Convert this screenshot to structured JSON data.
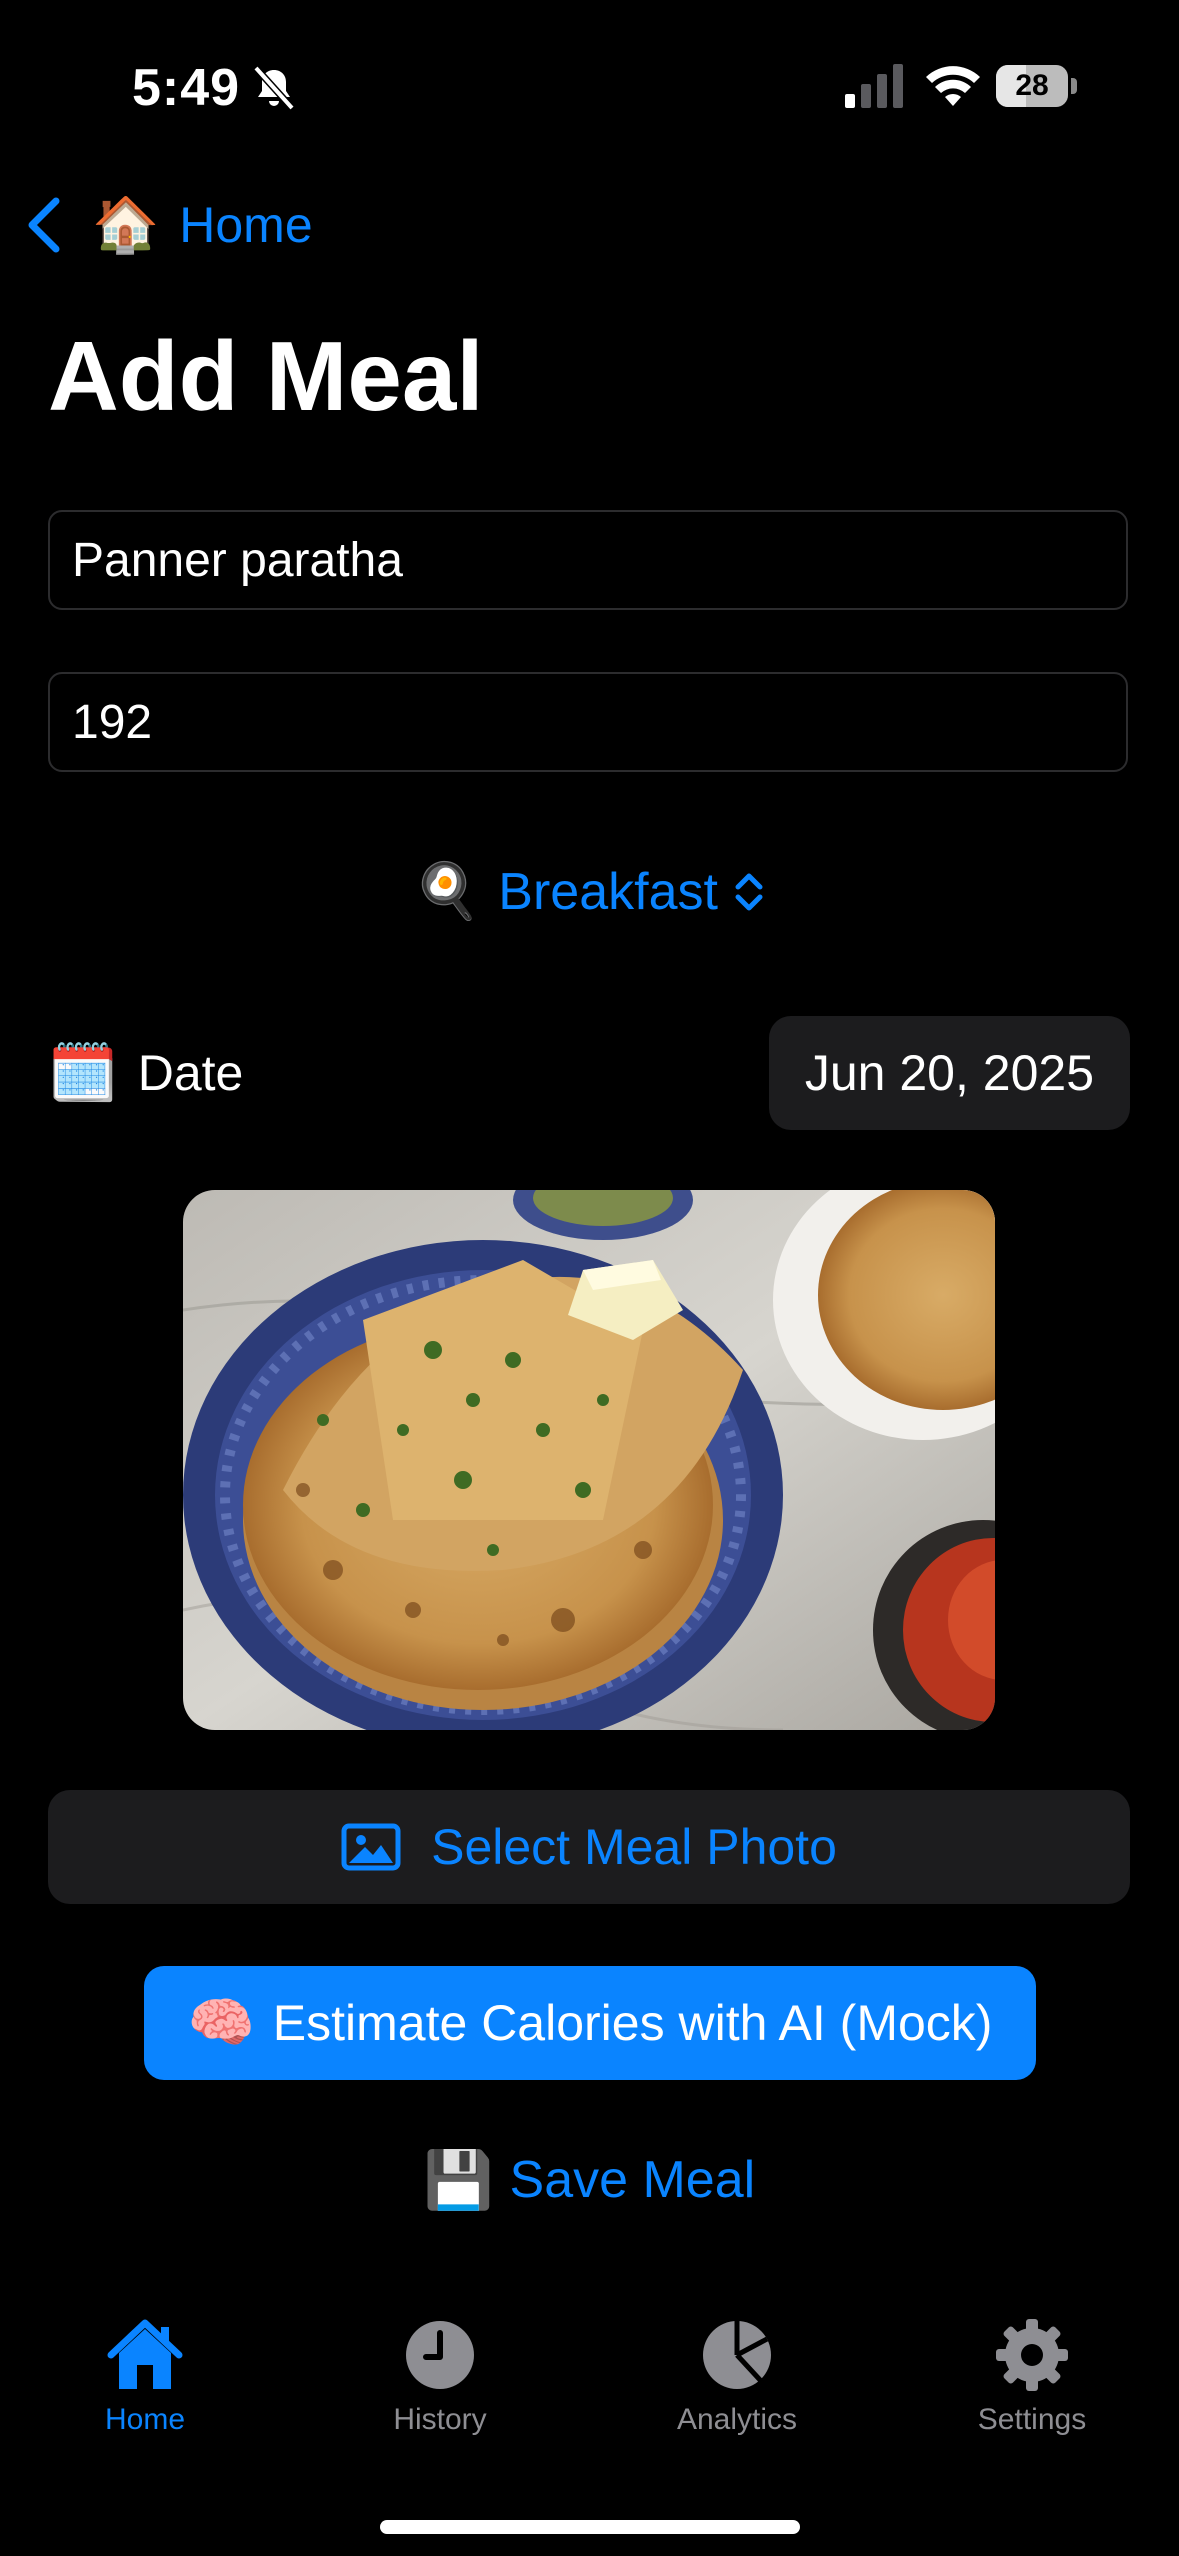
{
  "status_bar": {
    "time": "5:49",
    "battery": "28"
  },
  "nav": {
    "back_emoji": "🏠",
    "back_label": "Home"
  },
  "page": {
    "title": "Add Meal"
  },
  "form": {
    "meal_name": "Panner paratha",
    "calories": "192",
    "meal_type_emoji": "🍳",
    "meal_type": "Breakfast",
    "date_emoji": "🗓️",
    "date_label": "Date",
    "date_value": "Jun 20, 2025"
  },
  "actions": {
    "select_photo": "Select Meal Photo",
    "estimate_emoji": "🧠",
    "estimate": "Estimate Calories with AI (Mock)",
    "save_emoji": "💾",
    "save": "Save Meal"
  },
  "tabs": [
    {
      "label": "Home",
      "icon": "house-icon",
      "active": true
    },
    {
      "label": "History",
      "icon": "clock-icon",
      "active": false
    },
    {
      "label": "Analytics",
      "icon": "pie-chart-icon",
      "active": false
    },
    {
      "label": "Settings",
      "icon": "gear-icon",
      "active": false
    }
  ],
  "colors": {
    "accent": "#0a84ff",
    "background": "#000000",
    "surface": "#1c1c1e",
    "inactive": "#8e8e93"
  }
}
